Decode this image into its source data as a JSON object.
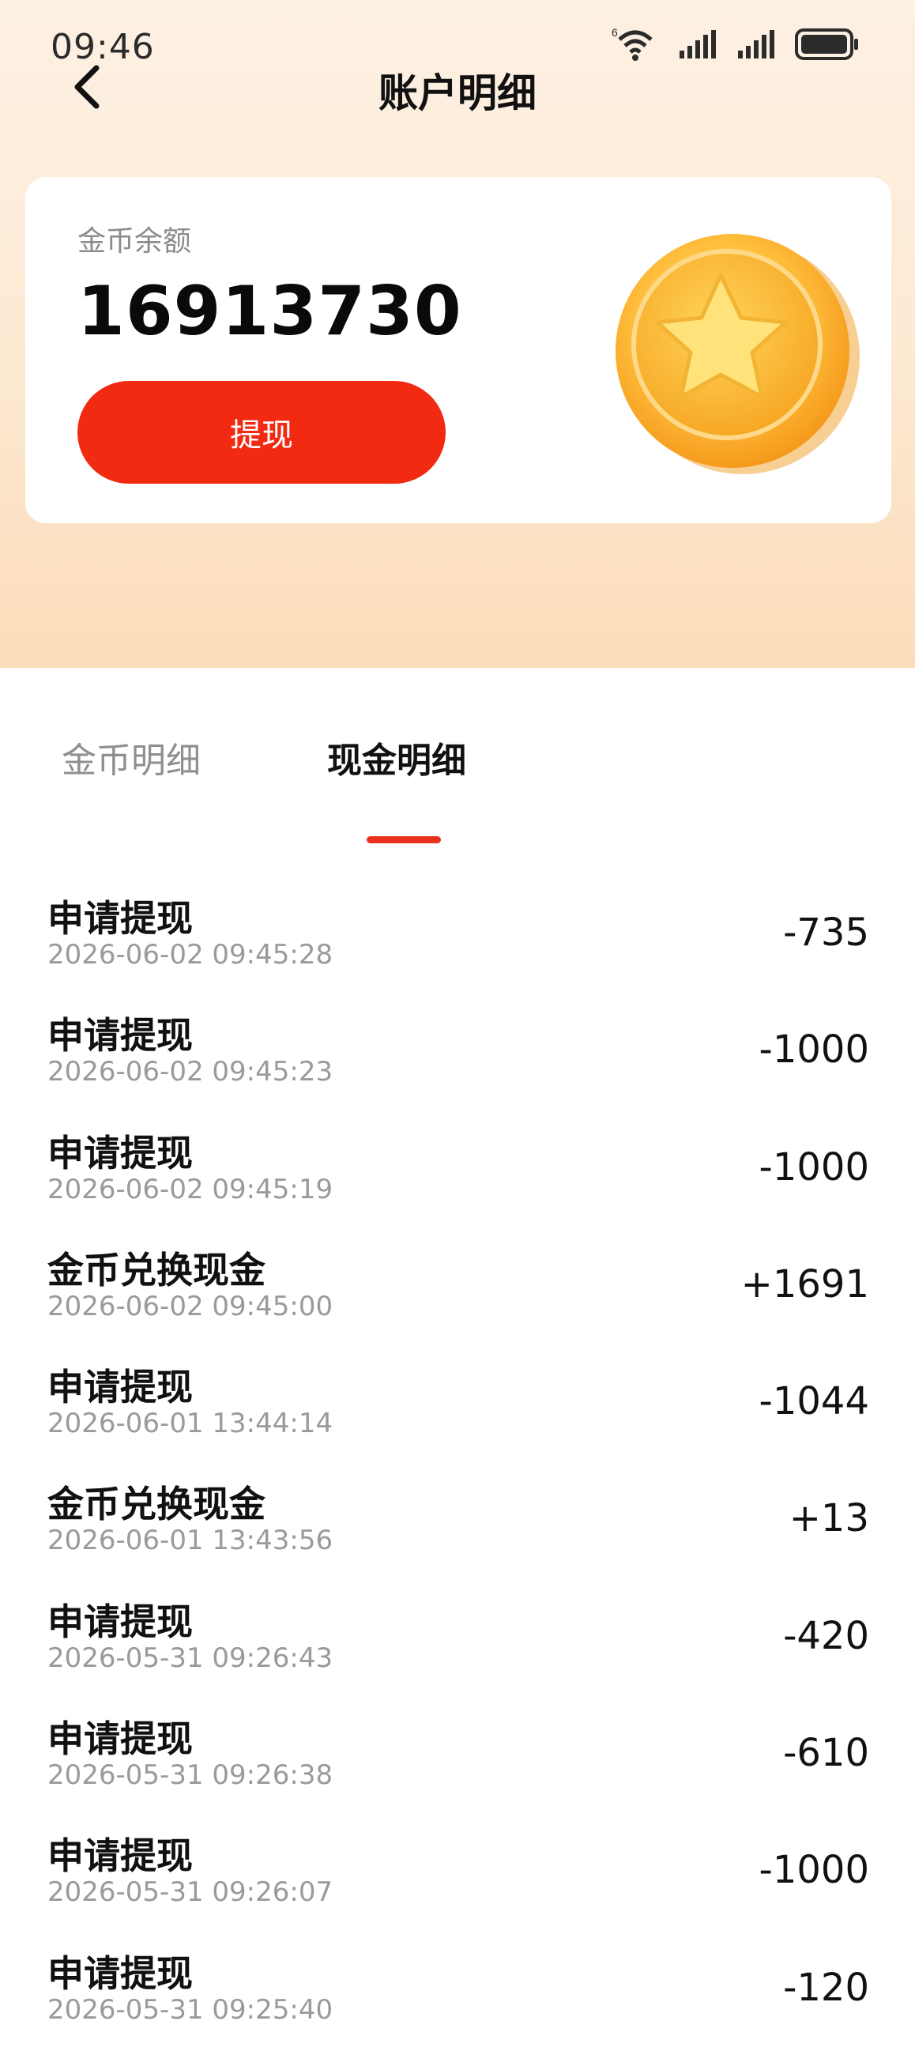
{
  "status_bar": {
    "time": "09:46",
    "network_badge": "6"
  },
  "header": {
    "title": "账户明细"
  },
  "balance": {
    "label": "金币余额",
    "value": "16913730",
    "withdraw_label": "提现"
  },
  "tabs": [
    {
      "label": "金币明细",
      "active": false
    },
    {
      "label": "现金明细",
      "active": true
    }
  ],
  "transactions": [
    {
      "title": "申请提现",
      "time": "2026-06-02 09:45:28",
      "amount": "-735"
    },
    {
      "title": "申请提现",
      "time": "2026-06-02 09:45:23",
      "amount": "-1000"
    },
    {
      "title": "申请提现",
      "time": "2026-06-02 09:45:19",
      "amount": "-1000"
    },
    {
      "title": "金币兑换现金",
      "time": "2026-06-02 09:45:00",
      "amount": "+1691"
    },
    {
      "title": "申请提现",
      "time": "2026-06-01 13:44:14",
      "amount": "-1044"
    },
    {
      "title": "金币兑换现金",
      "time": "2026-06-01 13:43:56",
      "amount": "+13"
    },
    {
      "title": "申请提现",
      "time": "2026-05-31 09:26:43",
      "amount": "-420"
    },
    {
      "title": "申请提现",
      "time": "2026-05-31 09:26:38",
      "amount": "-610"
    },
    {
      "title": "申请提现",
      "time": "2026-05-31 09:26:07",
      "amount": "-1000"
    },
    {
      "title": "申请提现",
      "time": "2026-05-31 09:25:40",
      "amount": "-120"
    }
  ],
  "colors": {
    "accent": "#f22a12",
    "indicator": "#e8321f",
    "header_bg": "#fde9d2"
  },
  "icons": [
    "back-arrow-icon",
    "wifi-icon",
    "signal-icon",
    "battery-icon",
    "gold-star-coin"
  ]
}
